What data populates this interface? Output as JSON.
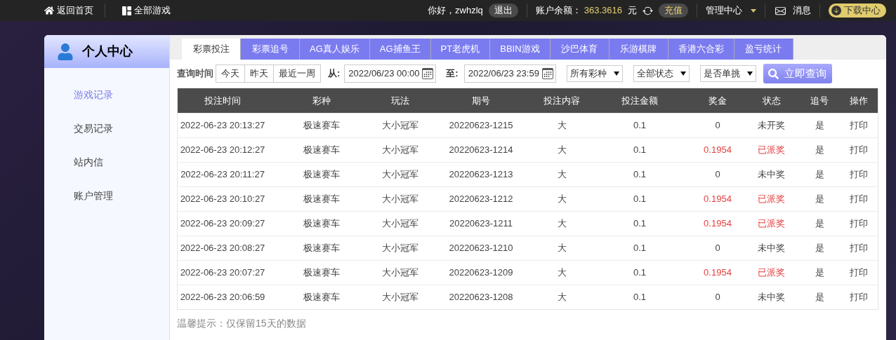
{
  "top_bar": {
    "home_link": "返回首页",
    "games_link": "全部游戏",
    "greeting": "你好，zwhzlq",
    "logout": "退出",
    "balance_label": "账户余额：",
    "balance": "363.3616",
    "currency": "元",
    "recharge": "充值",
    "manage_menu": "管理中心",
    "messages": "消息",
    "download": "下载中心"
  },
  "sidebar": {
    "title": "个人中心",
    "items": [
      {
        "label": "游戏记录",
        "selected": true
      },
      {
        "label": "交易记录",
        "selected": false
      },
      {
        "label": "站内信",
        "selected": false
      },
      {
        "label": "账户管理",
        "selected": false
      }
    ]
  },
  "tabs": [
    {
      "label": "彩票投注",
      "selected": true
    },
    {
      "label": "彩票追号",
      "selected": false
    },
    {
      "label": "AG真人娱乐",
      "selected": false
    },
    {
      "label": "AG捕鱼王",
      "selected": false
    },
    {
      "label": "PT老虎机",
      "selected": false
    },
    {
      "label": "BBIN游戏",
      "selected": false
    },
    {
      "label": "沙巴体育",
      "selected": false
    },
    {
      "label": "乐游棋牌",
      "selected": false
    },
    {
      "label": "香港六合彩",
      "selected": false
    },
    {
      "label": "盈亏统计",
      "selected": false
    }
  ],
  "filters": {
    "label": "查询时间",
    "quick_ranges": [
      "今天",
      "昨天",
      "最近一周"
    ],
    "from_label": "从:",
    "from_value": "2022/06/23 00:00",
    "to_label": "至:",
    "to_value": "2022/06/23 23:59",
    "selects": [
      "所有彩种",
      "全部状态",
      "是否单挑"
    ],
    "search_button": "立即查询"
  },
  "table": {
    "columns": [
      "投注时间",
      "彩种",
      "玩法",
      "期号",
      "投注内容",
      "投注金额",
      "奖金",
      "状态",
      "追号",
      "操作"
    ],
    "rows": [
      {
        "kind": "plain",
        "cells": [
          "2022-06-23 20:13:27",
          "极速赛车",
          "大小冠军",
          "20220623-1215",
          "大",
          "0.1",
          "0",
          "未开奖",
          "是",
          "打印"
        ]
      },
      {
        "kind": "win",
        "cells": [
          "2022-06-23 20:12:27",
          "极速赛车",
          "大小冠军",
          "20220623-1214",
          "大",
          "0.1",
          "0.1954",
          "已派奖",
          "是",
          "打印"
        ]
      },
      {
        "kind": "plain",
        "cells": [
          "2022-06-23 20:11:27",
          "极速赛车",
          "大小冠军",
          "20220623-1213",
          "大",
          "0.1",
          "0",
          "未中奖",
          "是",
          "打印"
        ]
      },
      {
        "kind": "win",
        "cells": [
          "2022-06-23 20:10:27",
          "极速赛车",
          "大小冠军",
          "20220623-1212",
          "大",
          "0.1",
          "0.1954",
          "已派奖",
          "是",
          "打印"
        ]
      },
      {
        "kind": "win",
        "cells": [
          "2022-06-23 20:09:27",
          "极速赛车",
          "大小冠军",
          "20220623-1211",
          "大",
          "0.1",
          "0.1954",
          "已派奖",
          "是",
          "打印"
        ]
      },
      {
        "kind": "plain",
        "cells": [
          "2022-06-23 20:08:27",
          "极速赛车",
          "大小冠军",
          "20220623-1210",
          "大",
          "0.1",
          "0",
          "未中奖",
          "是",
          "打印"
        ]
      },
      {
        "kind": "win",
        "cells": [
          "2022-06-23 20:07:27",
          "极速赛车",
          "大小冠军",
          "20220623-1209",
          "大",
          "0.1",
          "0.1954",
          "已派奖",
          "是",
          "打印"
        ]
      },
      {
        "kind": "plain",
        "cells": [
          "2022-06-23 20:06:59",
          "极速赛车",
          "大小冠军",
          "20220623-1208",
          "大",
          "0.1",
          "0",
          "未中奖",
          "是",
          "打印"
        ]
      }
    ]
  },
  "note": "温馨提示：仅保留15天的数据"
}
